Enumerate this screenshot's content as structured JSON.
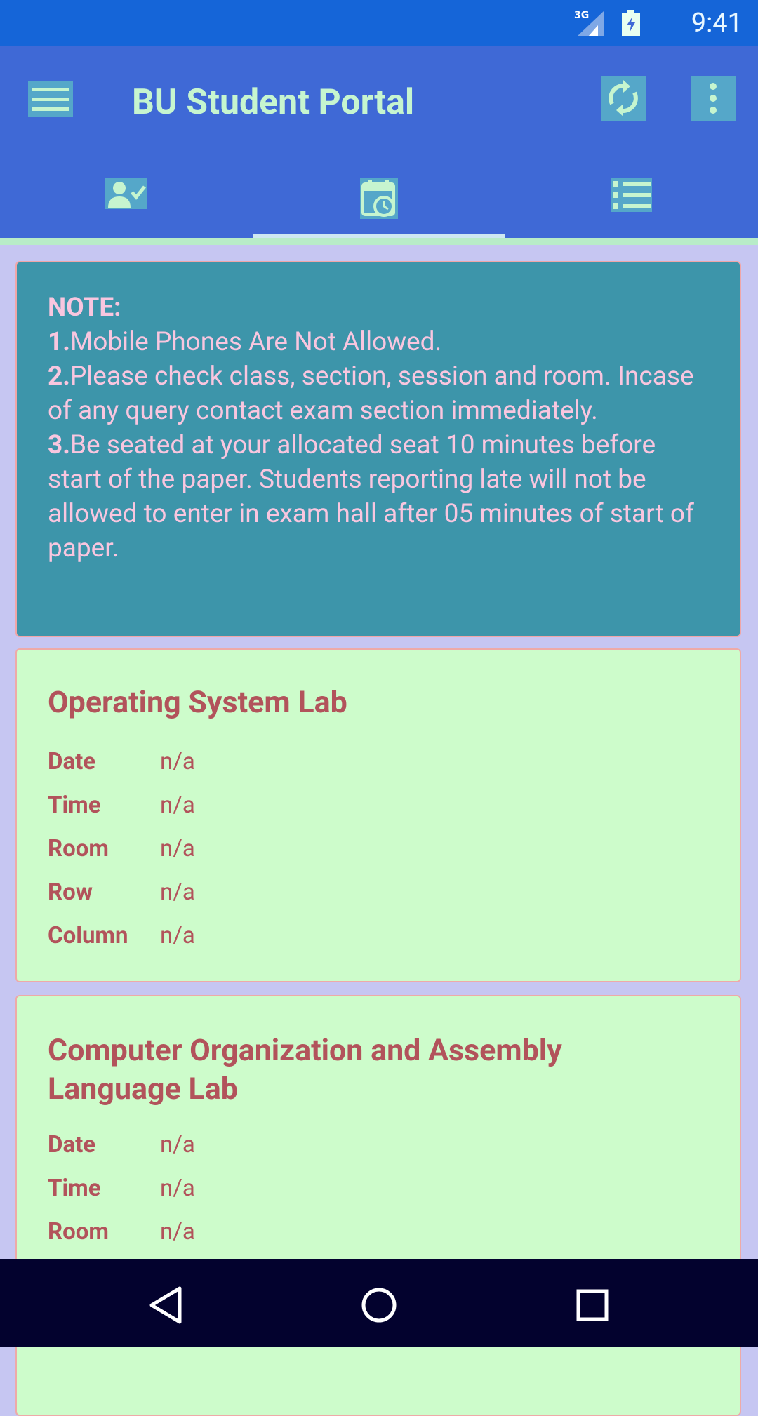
{
  "status_bar": {
    "network": "3G",
    "time": "9:41"
  },
  "app_bar": {
    "title": "BU Student Portal",
    "menu_icon": "hamburger-menu-icon",
    "refresh_icon": "refresh-icon",
    "more_icon": "more-vert-icon"
  },
  "tabs": [
    {
      "icon": "person-check-icon",
      "selected": false
    },
    {
      "icon": "calendar-clock-icon",
      "selected": true
    },
    {
      "icon": "list-icon",
      "selected": false
    }
  ],
  "note": {
    "heading": "NOTE:",
    "items": [
      {
        "num": "1.",
        "text": "Mobile Phones Are Not Allowed."
      },
      {
        "num": "2.",
        "text": "Please check class, section, session and room. Incase of any query contact exam section immediately."
      },
      {
        "num": "3.",
        "text": "Be seated at your allocated seat 10 minutes before start of the paper. Students reporting late will not be allowed to enter in exam hall after 05 minutes of start of paper."
      }
    ]
  },
  "exams": [
    {
      "title": "Operating System Lab",
      "fields": [
        {
          "label": "Date",
          "value": "n/a"
        },
        {
          "label": "Time",
          "value": "n/a"
        },
        {
          "label": "Room",
          "value": "n/a"
        },
        {
          "label": "Row",
          "value": "n/a"
        },
        {
          "label": "Column",
          "value": "n/a"
        }
      ]
    },
    {
      "title_line1": "Computer Organization and Assembly",
      "title_line2": "Language Lab",
      "fields": [
        {
          "label": "Date",
          "value": "n/a"
        },
        {
          "label": "Time",
          "value": "n/a"
        },
        {
          "label": "Room",
          "value": "n/a"
        }
      ]
    }
  ],
  "nav_bar": {
    "back_icon": "back-triangle-icon",
    "home_icon": "home-circle-icon",
    "recents_icon": "recents-square-icon"
  },
  "colors": {
    "status_bar": "#1565d8",
    "app_bar": "#3f69d6",
    "note_bg": "#3d95aa",
    "card_bg": "#cdfccb",
    "card_text": "#b2535b"
  }
}
